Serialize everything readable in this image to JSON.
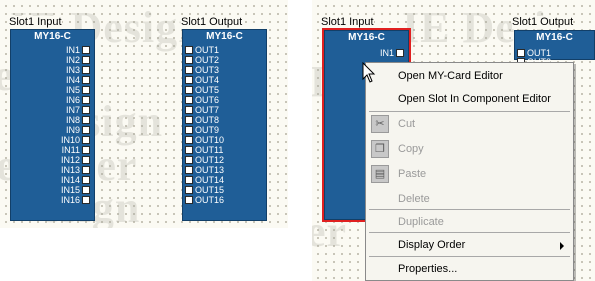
{
  "left_panel": {
    "watermark_lines": [
      "IE Design",
      "esign",
      "Design",
      "esigner",
      "esign"
    ],
    "input_slot": {
      "title": "Slot1 Input",
      "component_name": "MY16-C",
      "ports": [
        "IN1",
        "IN2",
        "IN3",
        "IN4",
        "IN5",
        "IN6",
        "IN7",
        "IN8",
        "IN9",
        "IN10",
        "IN11",
        "IN12",
        "IN13",
        "IN14",
        "IN15",
        "IN16"
      ]
    },
    "output_slot": {
      "title": "Slot1 Output",
      "component_name": "MY16-C",
      "ports": [
        "OUT1",
        "OUT2",
        "OUT3",
        "OUT4",
        "OUT5",
        "OUT6",
        "OUT7",
        "OUT8",
        "OUT9",
        "OUT10",
        "OUT11",
        "OUT12",
        "OUT13",
        "OUT14",
        "OUT15",
        "OUT16"
      ]
    }
  },
  "right_panel": {
    "watermark_lines": [
      "IE Desi",
      "D",
      "er",
      "",
      ""
    ],
    "input_slot": {
      "title": "Slot1 Input",
      "component_name": "MY16-C",
      "visible_port": "IN1"
    },
    "output_slot": {
      "title": "Slot1 Output",
      "component_name": "MY16-C",
      "visible_ports": [
        "OUT1",
        "OUT2"
      ]
    }
  },
  "context_menu": {
    "items": [
      {
        "label": "Open MY-Card Editor",
        "enabled": true,
        "icon": ""
      },
      {
        "label": "Open Slot In Component Editor",
        "enabled": true,
        "icon": ""
      },
      {
        "label": "Cut",
        "enabled": false,
        "icon": "scissors-icon"
      },
      {
        "label": "Copy",
        "enabled": false,
        "icon": "copy-icon"
      },
      {
        "label": "Paste",
        "enabled": false,
        "icon": "paste-icon"
      },
      {
        "label": "Delete",
        "enabled": false,
        "icon": ""
      },
      {
        "label": "Duplicate",
        "enabled": false,
        "icon": ""
      },
      {
        "label": "Display Order",
        "enabled": true,
        "icon": "",
        "submenu": true
      },
      {
        "label": "Properties...",
        "enabled": true,
        "icon": ""
      }
    ]
  },
  "colors": {
    "component_fill": "#1f5e97",
    "selection_outline": "#e02020",
    "canvas_background": "#fbfaf3"
  }
}
